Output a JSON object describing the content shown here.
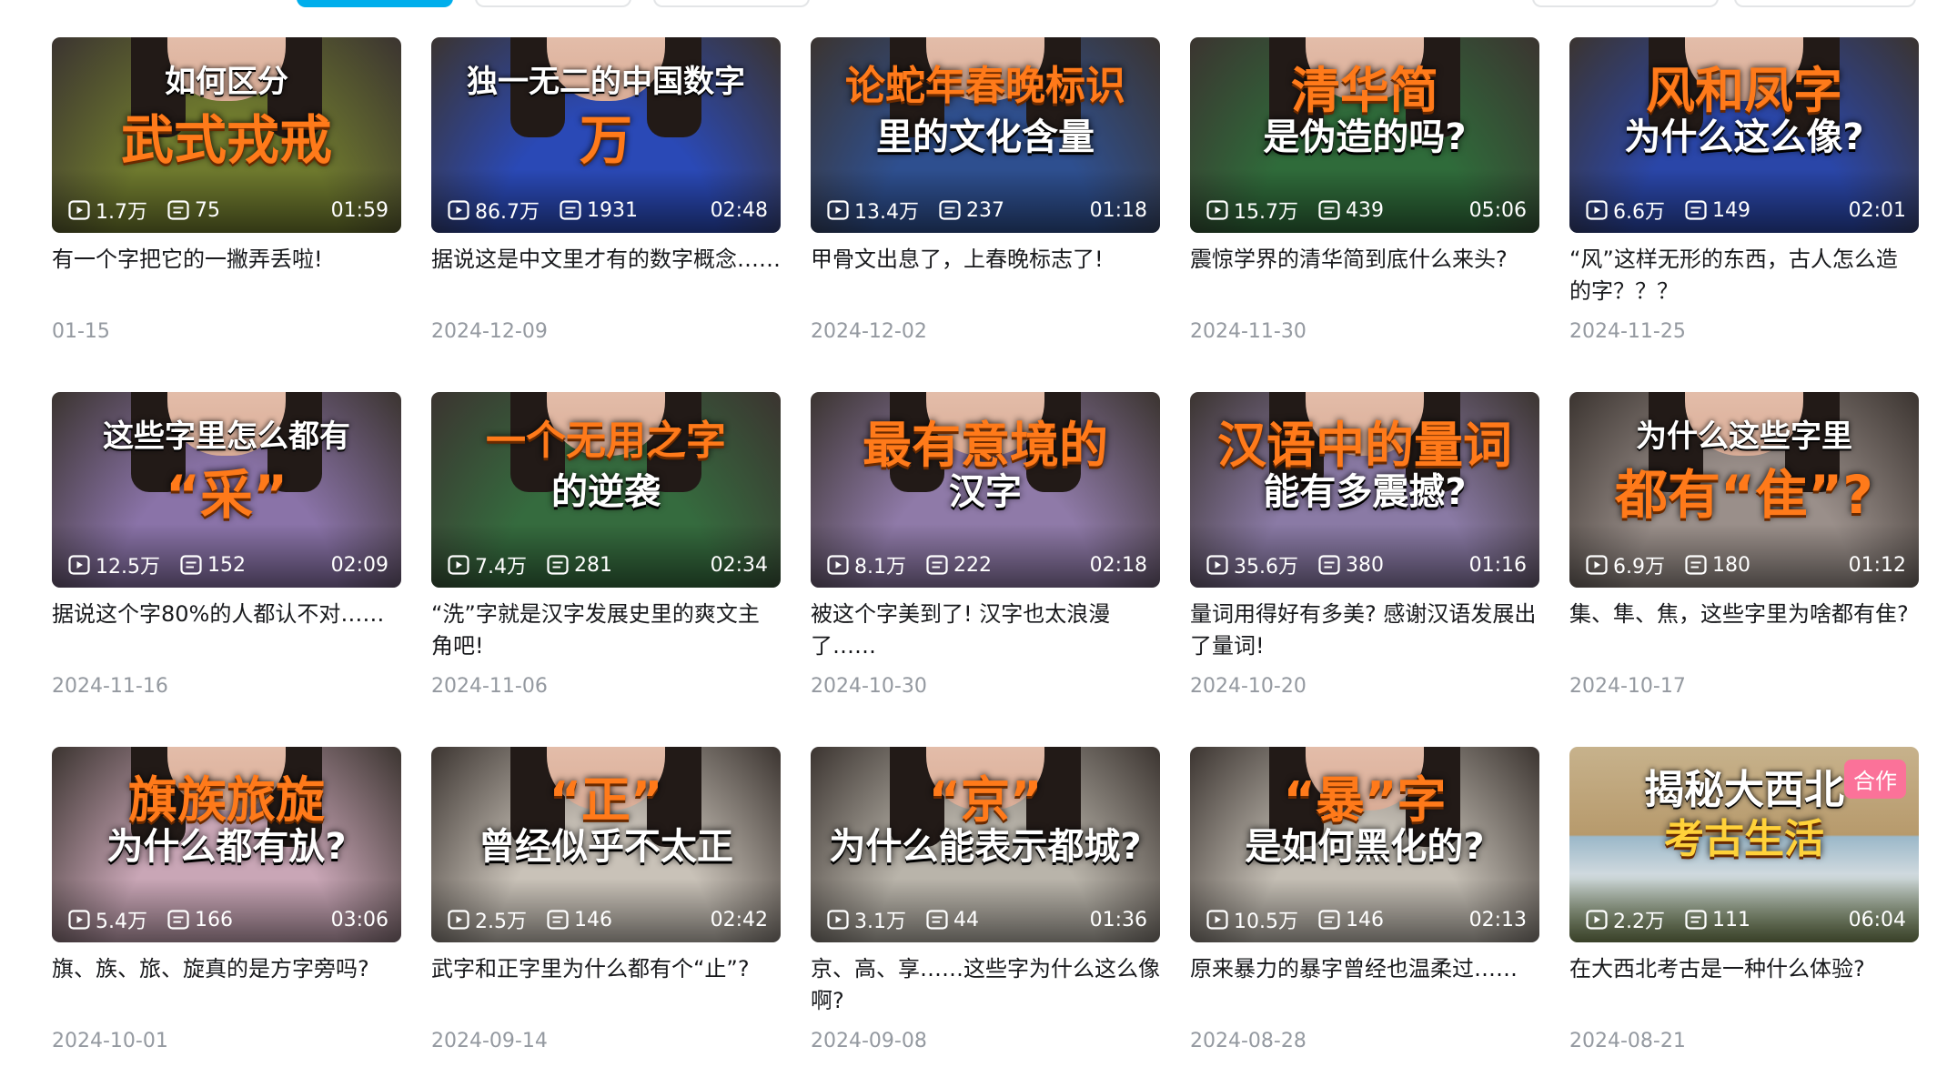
{
  "colors": {
    "accent": "#00aeec",
    "orange_text": "#ff7a1a",
    "date_gray": "#9499a0",
    "badge_pink": "#fb7299"
  },
  "videos": [
    {
      "line1": "如何区分",
      "line2": "武式戎戒",
      "line3": "",
      "views": "1.7万",
      "danmaku": "75",
      "duration": "01:59",
      "title": "有一个字把它的一撇弄丢啦!",
      "date": "01-15",
      "bg": "#6f7a2e",
      "style": "a",
      "badge": ""
    },
    {
      "line1": "独一无二的中国数字",
      "line2": "万",
      "line3": "",
      "views": "86.7万",
      "danmaku": "1931",
      "duration": "02:48",
      "title": "据说这是中文里才有的数字概念……",
      "date": "2024-12-09",
      "bg": "#2a49b6",
      "style": "a",
      "badge": ""
    },
    {
      "line1": "论蛇年春晚标识",
      "line2": "里的文化含量",
      "line3": "",
      "views": "13.4万",
      "danmaku": "237",
      "duration": "01:18",
      "title": "甲骨文出息了，上春晚标志了!",
      "date": "2024-12-02",
      "bg": "#2e4f8f",
      "style": "c",
      "badge": ""
    },
    {
      "line1": "清华简",
      "line2": "是伪造的吗?",
      "line3": "",
      "views": "15.7万",
      "danmaku": "439",
      "duration": "05:06",
      "title": "震惊学界的清华简到底什么来头?",
      "date": "2024-11-30",
      "bg": "#2f6b3a",
      "style": "b",
      "badge": ""
    },
    {
      "line1": "风和凤字",
      "line2": "为什么这么像?",
      "line3": "",
      "views": "6.6万",
      "danmaku": "149",
      "duration": "02:01",
      "title": "“风”这样无形的东西，古人怎么造的字？？？",
      "date": "2024-11-25",
      "bg": "#2a46a8",
      "style": "b",
      "badge": ""
    },
    {
      "line1": "这些字里怎么都有",
      "line2": "“采”",
      "line3": "",
      "views": "12.5万",
      "danmaku": "152",
      "duration": "02:09",
      "title": "据说这个字80%的人都认不对……",
      "date": "2024-11-16",
      "bg": "#8a73a8",
      "style": "a",
      "badge": ""
    },
    {
      "line1": "一个无用之字",
      "line2": "的逆袭",
      "line3": "",
      "views": "7.4万",
      "danmaku": "281",
      "duration": "02:34",
      "title": "“洗”字就是汉字发展史里的爽文主角吧!",
      "date": "2024-11-06",
      "bg": "#356b3e",
      "style": "c",
      "badge": ""
    },
    {
      "line1": "最有意境的",
      "line2": "汉字",
      "line3": "",
      "views": "8.1万",
      "danmaku": "222",
      "duration": "02:18",
      "title": "被这个字美到了! 汉字也太浪漫了……",
      "date": "2024-10-30",
      "bg": "#8f7aa8",
      "style": "b",
      "badge": ""
    },
    {
      "line1": "汉语中的量词",
      "line2": "能有多震撼?",
      "line3": "",
      "views": "35.6万",
      "danmaku": "380",
      "duration": "01:16",
      "title": "量词用得好有多美? 感谢汉语发展出了量词!",
      "date": "2024-10-20",
      "bg": "#8a7aa5",
      "style": "b",
      "badge": ""
    },
    {
      "line1": "为什么这些字里",
      "line2": "都有“隹”?",
      "line3": "",
      "views": "6.9万",
      "danmaku": "180",
      "duration": "01:12",
      "title": "集、隼、焦，这些字里为啥都有隹?",
      "date": "2024-10-17",
      "bg": "#9a8f8a",
      "style": "a",
      "badge": ""
    },
    {
      "line1": "旗族旅旋",
      "line2": "为什么都有㫃?",
      "line3": "",
      "views": "5.4万",
      "danmaku": "166",
      "duration": "03:06",
      "title": "旗、族、旅、旋真的是方字旁吗?",
      "date": "2024-10-01",
      "bg": "#c9a6b6",
      "style": "b",
      "badge": ""
    },
    {
      "line1": "“正”",
      "line2": "曾经似乎不太正",
      "line3": "",
      "views": "2.5万",
      "danmaku": "146",
      "duration": "02:42",
      "title": "武字和正字里为什么都有个“止”?",
      "date": "2024-09-14",
      "bg": "#c9c2b8",
      "style": "b",
      "badge": ""
    },
    {
      "line1": "“京”",
      "line2": "为什么能表示都城?",
      "line3": "",
      "views": "3.1万",
      "danmaku": "44",
      "duration": "01:36",
      "title": "京、高、享……这些字为什么这么像啊?",
      "date": "2024-09-08",
      "bg": "#b9b4aa",
      "style": "b",
      "badge": ""
    },
    {
      "line1": "“暴”字",
      "line2": "是如何黑化的?",
      "line3": "",
      "views": "10.5万",
      "danmaku": "146",
      "duration": "02:13",
      "title": "原来暴力的暴字曾经也温柔过……",
      "date": "2024-08-28",
      "bg": "#c4beb4",
      "style": "b",
      "badge": ""
    },
    {
      "line1": "揭秘大西北",
      "line2": "考古生活",
      "line3": "",
      "views": "2.2万",
      "danmaku": "111",
      "duration": "06:04",
      "title": "在大西北考古是一种什么体验?",
      "date": "2024-08-21",
      "bg": "#8aa7b8",
      "style": "d",
      "badge": "合作"
    }
  ]
}
